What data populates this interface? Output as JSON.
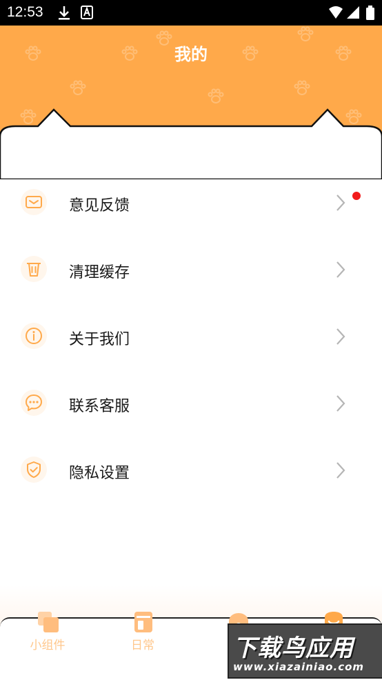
{
  "status_bar": {
    "time": "12:53"
  },
  "header": {
    "title": "我的"
  },
  "menu": {
    "items": [
      {
        "label": "意见反馈",
        "icon": "mail-icon",
        "has_badge": true
      },
      {
        "label": "清理缓存",
        "icon": "trash-icon"
      },
      {
        "label": "关于我们",
        "icon": "info-icon"
      },
      {
        "label": "联系客服",
        "icon": "chat-icon"
      },
      {
        "label": "隐私设置",
        "icon": "shield-icon"
      }
    ]
  },
  "tabbar": {
    "tabs": [
      {
        "label": "小组件",
        "icon": "widgets-icon"
      },
      {
        "label": "日常",
        "icon": "daily-icon"
      },
      {
        "label": "",
        "icon": "pet-house-icon"
      },
      {
        "label": "",
        "icon": "profile-icon"
      }
    ]
  },
  "watermark": {
    "title": "下载鸟应用",
    "url": "www.xiazainiao.com"
  },
  "colors": {
    "accent": "#ffa94a",
    "icon": "#ffa94a",
    "badge": "#f21b1b",
    "tab_label": "#ffc78c"
  }
}
